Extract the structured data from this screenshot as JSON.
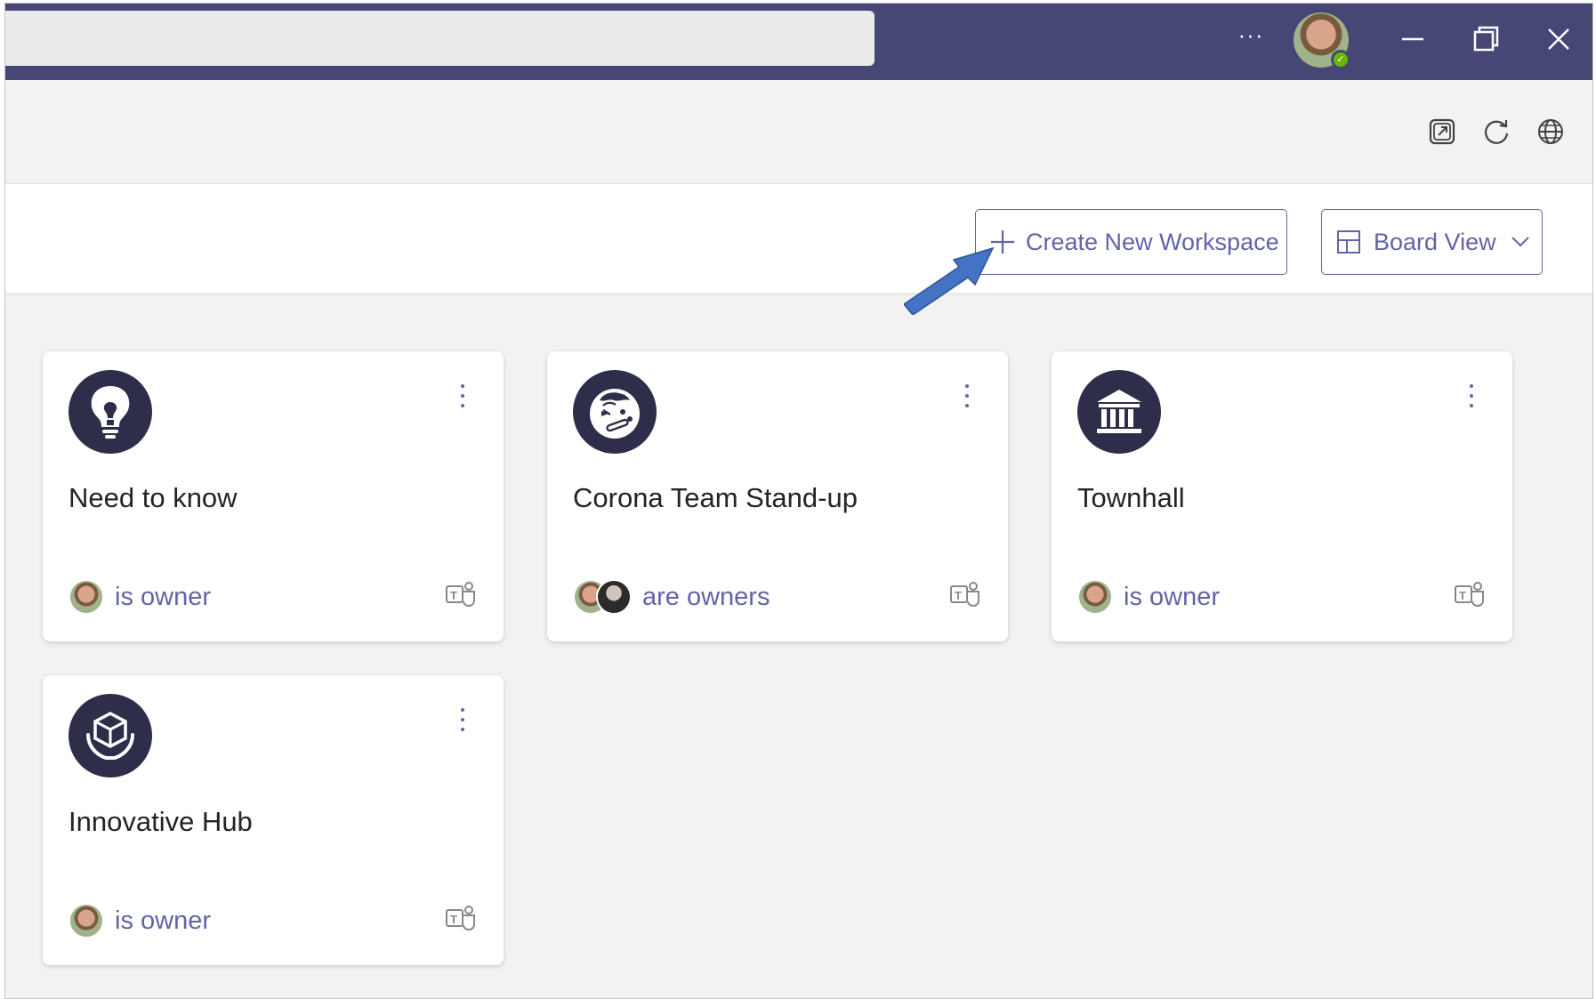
{
  "titlebar": {
    "more_label": "···",
    "icons": [
      "more-icon",
      "user-avatar",
      "minimize-icon",
      "restore-icon",
      "close-icon"
    ],
    "status": "available"
  },
  "header_icons": [
    "popout-icon",
    "refresh-icon",
    "globe-icon"
  ],
  "toolbar": {
    "create_label": "Create New Workspace",
    "view_label": "Board View"
  },
  "workspaces": [
    {
      "title": "Need to know",
      "owner_text": "is owner",
      "icon": "lightbulb-icon"
    },
    {
      "title": "Corona Team Stand-up",
      "owner_text": "are owners",
      "icon": "sick-face-icon"
    },
    {
      "title": "Townhall",
      "owner_text": "is owner",
      "icon": "building-icon"
    },
    {
      "title": "Innovative Hub",
      "owner_text": "is owner",
      "icon": "hands-cube-icon"
    }
  ],
  "colors": {
    "titlebar": "#464775",
    "accent": "#6264a7",
    "logo_bg": "#2e2e4a",
    "annotation_arrow": "#4472c4"
  }
}
